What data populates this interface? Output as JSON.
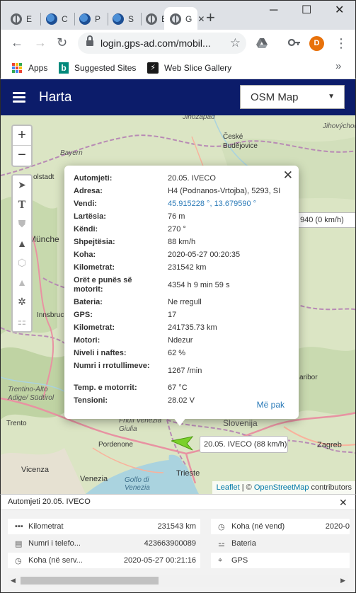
{
  "browser": {
    "tabs": [
      {
        "label": "E",
        "icon": "globe-icon"
      },
      {
        "label": "C",
        "icon": "satellite-icon"
      },
      {
        "label": "P",
        "icon": "satellite-icon"
      },
      {
        "label": "S",
        "icon": "satellite-icon"
      },
      {
        "label": "E",
        "icon": "globe-icon"
      },
      {
        "label": "G",
        "icon": "globe-icon",
        "active": true
      }
    ],
    "url": "login.gps-ad.com/mobil...",
    "profile_initial": "D",
    "bookmarks": [
      "Apps",
      "Suggested Sites",
      "Web Slice Gallery"
    ]
  },
  "app": {
    "title": "Harta",
    "map_type": "OSM Map"
  },
  "map": {
    "labels": {
      "jihozapad": "Jihozapad",
      "jihovychodni": "Jihovýchodni",
      "ceske_budejovice": "České Budějovice",
      "bayern": "Bayern",
      "olstadt": "olstadt",
      "munchen": "Münche",
      "innsbruck": "Innsbruck",
      "trentino": "Trentino-Alto Adige/ Südtirol",
      "trento": "Trento",
      "vicenza": "Vicenza",
      "venezia": "Venezia",
      "pordenone": "Pordenone",
      "friuli": "Friuli Venezia Giulia",
      "slovenija": "Slovenija",
      "zagreb": "Zagreb",
      "maribor": "aribor",
      "trieste": "Trieste",
      "golfo": "Golfo di Venezia"
    },
    "zoom_in": "+",
    "zoom_out": "−",
    "other_vehicle_tooltip": "940 (0 km/h)",
    "vehicle_tooltip": "20.05. IVECO (88 km/h)",
    "attribution": {
      "leaflet": "Leaflet",
      "sep": " | © ",
      "osm": "OpenStreetMap",
      "suffix": " contributors"
    }
  },
  "popup": {
    "rows": [
      {
        "k": "Automjeti:",
        "v": "20.05. IVECO"
      },
      {
        "k": "Adresa:",
        "v": "H4 (Podnanos-Vrtojba), 5293, SI"
      },
      {
        "k": "Vendi:",
        "v": "45.915228 °, 13.679590 °",
        "link": true
      },
      {
        "k": "Lartësia:",
        "v": "76 m"
      },
      {
        "k": "Këndi:",
        "v": "270 °"
      },
      {
        "k": "Shpejtësia:",
        "v": "88 km/h"
      },
      {
        "k": "Koha:",
        "v": "2020-05-27 00:20:35"
      },
      {
        "k": "Kilometrat:",
        "v": "231542 km"
      },
      {
        "k": "Orët e punës së motorit:",
        "v": "4354 h 9 min 59 s"
      },
      {
        "k": "Bateria:",
        "v": "Ne rregull"
      },
      {
        "k": "GPS:",
        "v": "17"
      },
      {
        "k": "Kilometrat:",
        "v": "241735.73 km"
      },
      {
        "k": "Motori:",
        "v": "Ndezur"
      },
      {
        "k": "Niveli i naftes:",
        "v": "62 %"
      },
      {
        "k": "Numri i rrotullimeve:",
        "v": "1267 /min"
      },
      {
        "k": "Temp. e motorrit:",
        "v": "67 °C"
      },
      {
        "k": "Tensioni:",
        "v": "28.02 V"
      }
    ],
    "more": "Më pak"
  },
  "details": {
    "title": "Automjeti 20.05. IVECO",
    "left": [
      {
        "icon": "odometer-icon",
        "label": "Kilometrat",
        "value": "231543 km"
      },
      {
        "icon": "sim-card-icon",
        "label": "Numri i telefo...",
        "value": "423663900089"
      },
      {
        "icon": "clock-icon",
        "label": "Koha (në serv...",
        "value": "2020-05-27 00:21:16"
      }
    ],
    "right": [
      {
        "icon": "clock-icon",
        "label": "Koha (në vend)",
        "value": "2020-0"
      },
      {
        "icon": "battery-icon",
        "label": "Bateria",
        "value": ""
      },
      {
        "icon": "satellite-dish-icon",
        "label": "GPS",
        "value": ""
      }
    ]
  },
  "colors": {
    "appbar": "#0c1c6a",
    "link": "#2a7ab8",
    "vehicle": "#7bd02b"
  }
}
